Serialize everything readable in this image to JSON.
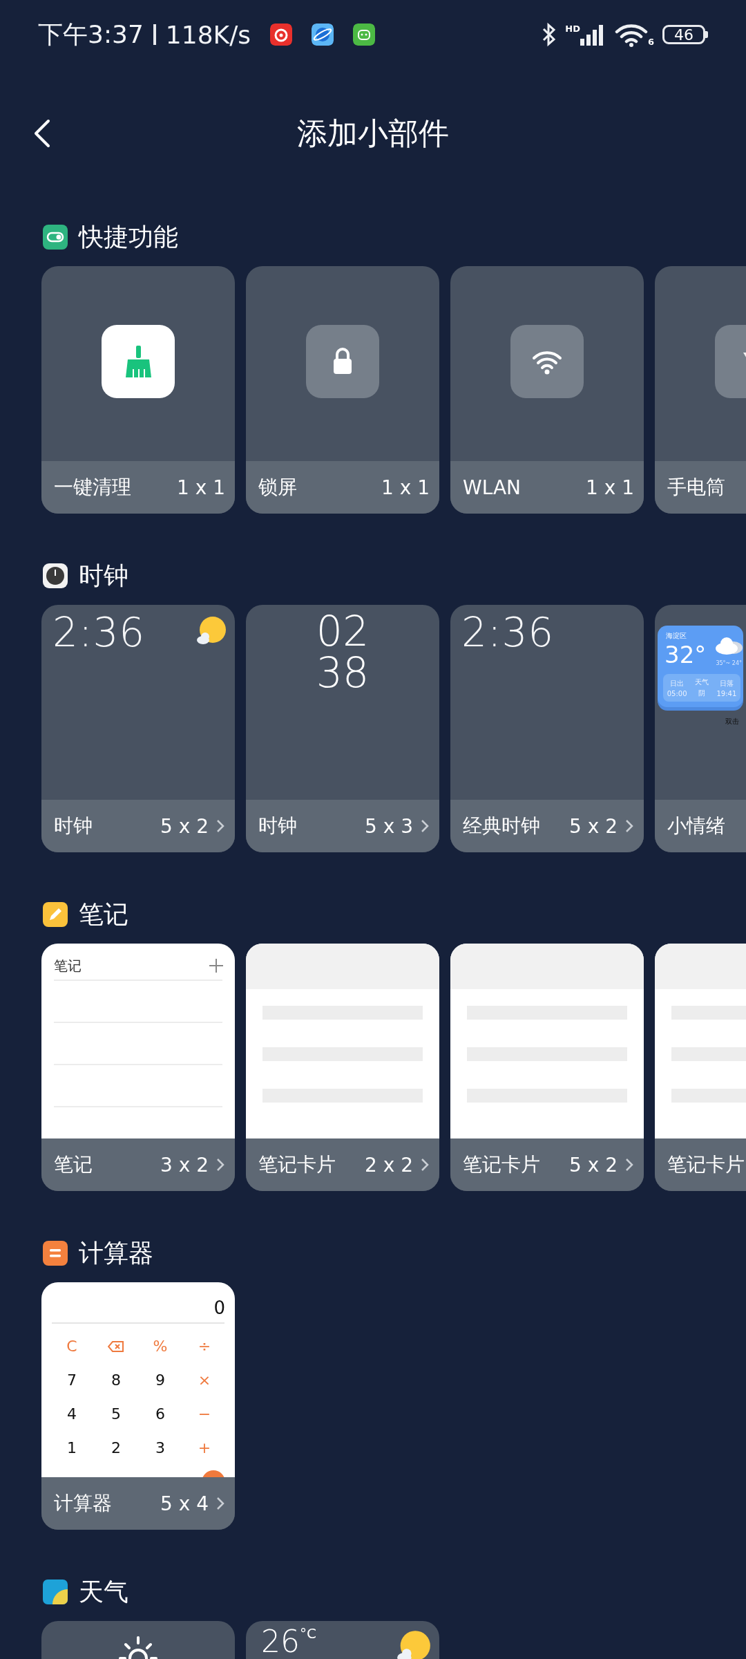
{
  "status_bar": {
    "time": "下午3:37",
    "speed": "118K/s",
    "network": "HD",
    "wifi_band": "6",
    "battery": "46"
  },
  "header": {
    "title": "添加小部件"
  },
  "sections": [
    {
      "title": "快捷功能",
      "widgets": [
        {
          "label": "一键清理",
          "size": "1 x 1",
          "has_arrow": false,
          "preview": {
            "kind": "tile"
          }
        },
        {
          "label": "锁屏",
          "size": "1 x 1",
          "has_arrow": false,
          "preview": {
            "kind": "tile"
          }
        },
        {
          "label": "WLAN",
          "size": "1 x 1",
          "has_arrow": false,
          "preview": {
            "kind": "tile"
          }
        },
        {
          "label": "手电筒",
          "preview": {
            "kind": "tile"
          }
        }
      ]
    },
    {
      "title": "时钟",
      "widgets": [
        {
          "label": "时钟",
          "size": "5 x 2",
          "has_arrow": true,
          "preview": {
            "kind": "clock",
            "time": "2:36",
            "weather_icon": true
          }
        },
        {
          "label": "时钟",
          "size": "5 x 3",
          "has_arrow": true,
          "preview": {
            "kind": "clock_stacked",
            "hours": "02",
            "minutes": "38"
          }
        },
        {
          "label": "经典时钟",
          "size": "5 x 2",
          "has_arrow": true,
          "preview": {
            "kind": "clock",
            "time": "2:36",
            "weather_icon": false
          }
        },
        {
          "label": "小情绪",
          "preview": {
            "kind": "weather_card",
            "place": "海淀区",
            "temp": "32°",
            "range": "35°~ 24°",
            "items": [
              {
                "label": "日出",
                "value": "05:00"
              },
              {
                "label": "天气",
                "value": "阴"
              },
              {
                "label": "日落",
                "value": "19:41"
              }
            ],
            "caption": "双击"
          }
        }
      ]
    },
    {
      "title": "笔记",
      "widgets": [
        {
          "label": "笔记",
          "size": "3 x 2",
          "has_arrow": true,
          "preview": {
            "kind": "note",
            "title": "笔记"
          }
        },
        {
          "label": "笔记卡片",
          "size": "2 x 2",
          "has_arrow": true,
          "preview": {
            "kind": "note_skeleton"
          }
        },
        {
          "label": "笔记卡片",
          "size": "5 x 2",
          "has_arrow": true,
          "preview": {
            "kind": "note_skeleton"
          }
        },
        {
          "label": "笔记卡片",
          "preview": {
            "kind": "note_skeleton"
          }
        }
      ]
    },
    {
      "title": "计算器",
      "widgets": [
        {
          "label": "计算器",
          "size": "5 x 4",
          "has_arrow": true,
          "preview": {
            "kind": "calculator",
            "display": "0",
            "keys": [
              {
                "kind": "op",
                "text": "C"
              },
              {
                "kind": "backspace"
              },
              {
                "kind": "op",
                "text": "%"
              },
              {
                "kind": "op",
                "text": "÷"
              },
              {
                "kind": "digit",
                "text": "7"
              },
              {
                "kind": "digit",
                "text": "8"
              },
              {
                "kind": "digit",
                "text": "9"
              },
              {
                "kind": "op",
                "text": "×"
              },
              {
                "kind": "digit",
                "text": "4"
              },
              {
                "kind": "digit",
                "text": "5"
              },
              {
                "kind": "digit",
                "text": "6"
              },
              {
                "kind": "op",
                "text": "−"
              },
              {
                "kind": "digit",
                "text": "1"
              },
              {
                "kind": "digit",
                "text": "2"
              },
              {
                "kind": "digit",
                "text": "3"
              },
              {
                "kind": "op",
                "text": "+"
              }
            ]
          }
        }
      ]
    },
    {
      "title": "天气",
      "widgets": [
        {
          "preview": {
            "kind": "sun"
          }
        },
        {
          "preview": {
            "kind": "temperature",
            "temp": "26",
            "unit": "°C"
          }
        }
      ]
    }
  ]
}
